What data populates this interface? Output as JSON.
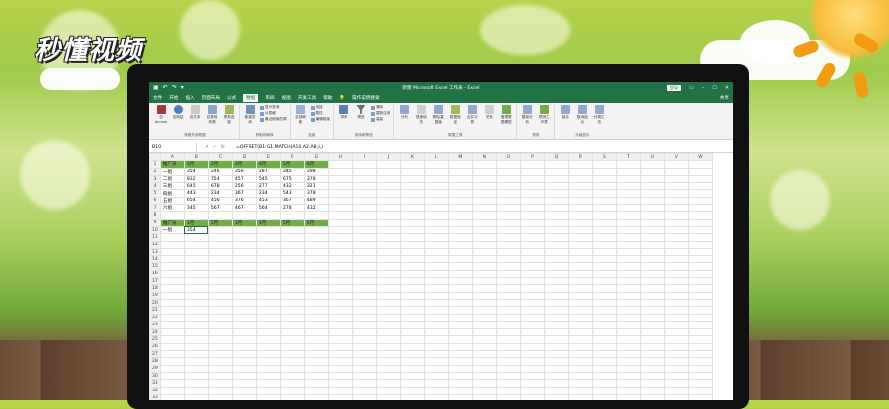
{
  "watermark": {
    "logo_text": "秒懂视频"
  },
  "excel": {
    "window_title": "新建 Microsoft Excel 工作表 - Excel",
    "login_label": "登录",
    "share_label": "共享",
    "tell_me": "操作说明搜索",
    "menu_tabs": [
      "文件",
      "开始",
      "插入",
      "页面布局",
      "公式",
      "数据",
      "审阅",
      "视图",
      "开发工具",
      "帮助"
    ],
    "active_tab": "数据",
    "ribbon_groups": [
      {
        "label": "获取外部数据",
        "buttons": [
          "自 Access",
          "自网站",
          "自文本",
          "自其他来源",
          "现有连接"
        ]
      },
      {
        "label": "获取和转换",
        "buttons": [
          "新建查询"
        ],
        "small": [
          "显示查询",
          "从表格",
          "最近使用的源"
        ]
      },
      {
        "label": "连接",
        "buttons": [
          "全部刷新"
        ],
        "small": [
          "连接",
          "属性",
          "编辑链接"
        ]
      },
      {
        "label": "排序和筛选",
        "buttons": [
          "排序",
          "筛选"
        ],
        "small": [
          "清除",
          "重新应用",
          "高级"
        ]
      },
      {
        "label": "数据工具",
        "buttons": [
          "分列",
          "快速填充",
          "删除重复值",
          "数据验证",
          "合并计算",
          "关系",
          "管理数据模型"
        ]
      },
      {
        "label": "预测",
        "buttons": [
          "模拟分析",
          "预测工作表"
        ]
      },
      {
        "label": "分级显示",
        "buttons": [
          "组合",
          "取消组合",
          "分类汇总"
        ]
      }
    ],
    "name_box": "B10",
    "formula": "=OFFSET(B1:G1,MATCH(A10,A2:A8,),)",
    "columns": [
      "A",
      "B",
      "C",
      "D",
      "E",
      "F",
      "G",
      "H",
      "I",
      "J",
      "K",
      "L",
      "M",
      "N",
      "O",
      "P",
      "Q",
      "R",
      "S",
      "T",
      "U",
      "V",
      "W"
    ],
    "header_row": [
      "推广员",
      "1月",
      "2月",
      "3月",
      "4月",
      "5月",
      "6月"
    ],
    "data_rows": [
      [
        "一组",
        "354",
        "246",
        "356",
        "287",
        "345",
        "298"
      ],
      [
        "二组",
        "832",
        "754",
        "457",
        "545",
        "675",
        "378"
      ],
      [
        "三组",
        "645",
        "678",
        "256",
        "277",
        "432",
        "321"
      ],
      [
        "四组",
        "443",
        "234",
        "367",
        "234",
        "543",
        "378"
      ],
      [
        "五组",
        "654",
        "456",
        "376",
        "453",
        "367",
        "489"
      ],
      [
        "六组",
        "345",
        "567",
        "467",
        "564",
        "278",
        "432"
      ]
    ],
    "header_row2": [
      "推广员",
      "1月",
      "2月",
      "3月",
      "4月",
      "5月",
      "6月"
    ],
    "lookup_row": [
      "一组",
      "354"
    ],
    "row_numbers": [
      "1",
      "2",
      "3",
      "4",
      "5",
      "6",
      "7",
      "8",
      "9",
      "10",
      "11",
      "12",
      "13",
      "14",
      "15",
      "16",
      "17",
      "18",
      "19",
      "20",
      "21",
      "22",
      "23",
      "24",
      "25",
      "26",
      "27",
      "28",
      "29",
      "30",
      "31",
      "32",
      "33"
    ],
    "sheet_tab": "Sheet1",
    "colors": {
      "excel_green": "#217346",
      "header_fill": "#70ad47"
    }
  }
}
